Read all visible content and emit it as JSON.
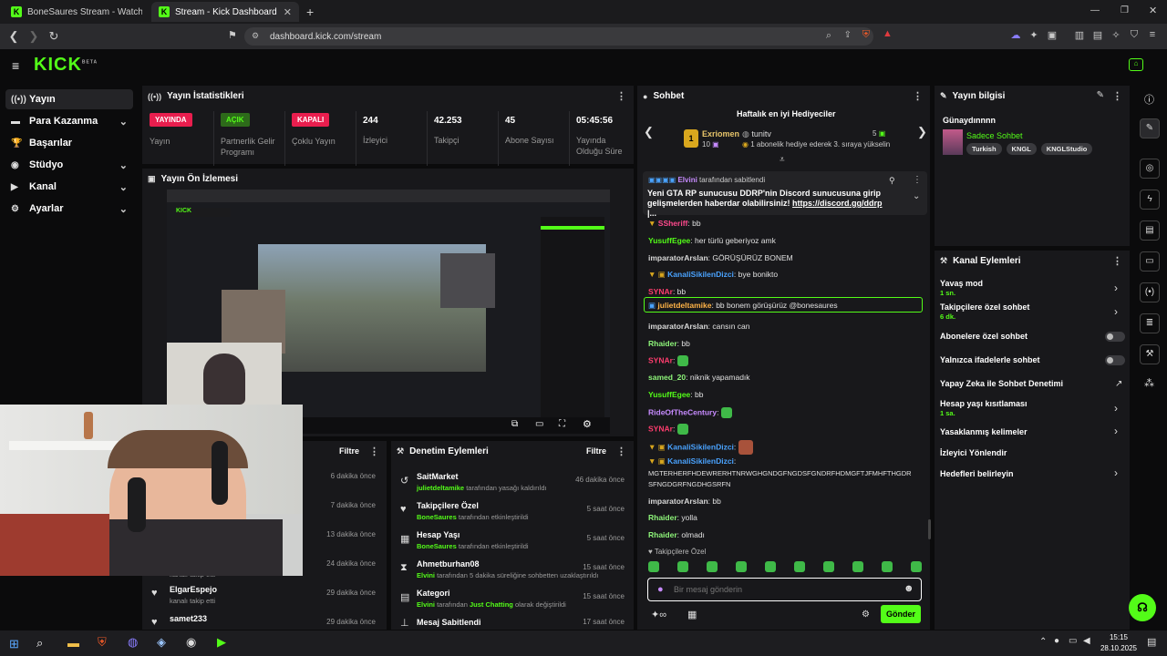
{
  "browser": {
    "tabs": [
      {
        "label": "BoneSaures Stream - Watch Live on"
      },
      {
        "label": "Stream - Kick Dashboard"
      }
    ],
    "new_tab": "+",
    "url": "dashboard.kick.com/stream"
  },
  "site": {
    "logo": "KICK",
    "logo_beta": "BETA"
  },
  "sidebar": {
    "items": [
      {
        "label": "Yayın",
        "icon": "broadcast-icon"
      },
      {
        "label": "Para Kazanma",
        "icon": "money-icon"
      },
      {
        "label": "Başarılar",
        "icon": "trophy-icon"
      },
      {
        "label": "Stüdyo",
        "icon": "studio-icon"
      },
      {
        "label": "Kanal",
        "icon": "channel-icon"
      },
      {
        "label": "Ayarlar",
        "icon": "gear-icon"
      }
    ]
  },
  "stats": {
    "title": "Yayın İstatistikleri",
    "items": [
      {
        "badge": "YAYINDA",
        "label": "Yayın"
      },
      {
        "badge": "AÇIK",
        "label": "Partnerlik Gelir Programı"
      },
      {
        "badge": "KAPALI",
        "label": "Çoklu Yayın"
      },
      {
        "value": "244",
        "label": "İzleyici"
      },
      {
        "value": "42.253",
        "label": "Takipçi"
      },
      {
        "value": "45",
        "label": "Abone Sayısı"
      },
      {
        "value": "05:45:56",
        "label": "Yayında Olduğu Süre"
      }
    ]
  },
  "preview": {
    "title": "Yayın Ön İzlemesi"
  },
  "activity": {
    "filter": "Filtre",
    "rows": [
      {
        "time": "6 dakika önce"
      },
      {
        "time": "7 dakika önce"
      },
      {
        "time": "13 dakika önce"
      },
      {
        "time": "24 dakika önce",
        "sub": "kanalı takip etti"
      },
      {
        "name": "ElgarEspejo",
        "sub": "kanalı takip etti",
        "time": "29 dakika önce"
      },
      {
        "name": "samet233",
        "time": "29 dakika önce"
      }
    ]
  },
  "moderation": {
    "title": "Denetim Eylemleri",
    "filter": "Filtre",
    "rows": [
      {
        "name": "SaitMarket",
        "actor": "julietdeltamike",
        "text": " tarafından yasağı kaldırıldı",
        "time": "46 dakika önce"
      },
      {
        "name": "Takipçilere Özel",
        "actor": "BoneSaures",
        "text": " tarafından etkinleştirildi",
        "time": "5 saat önce"
      },
      {
        "name": "Hesap Yaşı",
        "actor": "BoneSaures",
        "text": " tarafından etkinleştirildi",
        "time": "5 saat önce"
      },
      {
        "name": "Ahmetburhan08",
        "actor": "Elvini",
        "text": " tarafından 5 dakika süreliğine sohbetten uzaklaştırıldı",
        "time": "15 saat önce"
      },
      {
        "name": "Kategori",
        "actor": "Elvini",
        "text": " tarafından ",
        "extra": "Just Chatting",
        "text2": " olarak değiştirildi",
        "time": "15 saat önce"
      },
      {
        "name": "Mesaj Sabitlendi",
        "time": "17 saat önce"
      }
    ]
  },
  "chat": {
    "title": "Sohbet",
    "gifters_title": "Haftalık en iyi Hediyeciler",
    "gifter1": {
      "rank": "1",
      "name": "Exriomen",
      "count": "10"
    },
    "gifter2": {
      "name": "tunitv",
      "count": "5"
    },
    "gifter_note": "1 abonelik hediye ederek 3. sıraya yükselin",
    "pinned_by": "Elvini",
    "pinned_suffix": "tarafından sabitlendi",
    "pinned_text": "Yeni GTA RP sunucusu DDRP'nin Discord sunucusuna girip gelişmelerden haberdar olabilirsiniz! ",
    "pinned_link": "https://discord.gg/ddrp",
    "pinned_more": " |...",
    "messages": [
      {
        "user": "SSheriff",
        "color": "#ff4a8d",
        "text": "bb"
      },
      {
        "user": "YusuffEgee",
        "color": "#53fc18",
        "text": "her türlü geberiyoz amk"
      },
      {
        "user": "imparatorArslan",
        "color": "#d8d8d8",
        "text": "GÖRÜŞÜRÜZ BONEM"
      },
      {
        "user": "KanaliSikilenDizci",
        "color": "#4aa3ff",
        "text": "bye bonikto"
      },
      {
        "user": "SYNAr",
        "color": "#ff3d6e",
        "text": "bb"
      },
      {
        "user": "julietdeltamike",
        "color": "#ffb347",
        "text": "bb bonem görüşürüz @bonesaures"
      },
      {
        "user": "imparatorArslan",
        "color": "#d8d8d8",
        "text": "cansın can"
      },
      {
        "user": "Rhaider",
        "color": "#8ef57a",
        "text": "bb"
      },
      {
        "user": "SYNAr",
        "color": "#ff3d6e",
        "text": ""
      },
      {
        "user": "samed_20",
        "color": "#8ef57a",
        "text": "niknik yapamadık"
      },
      {
        "user": "YusuffEgee",
        "color": "#53fc18",
        "text": "bb"
      },
      {
        "user": "RideOfTheCentury",
        "color": "#c78bff",
        "text": ""
      },
      {
        "user": "SYNAr",
        "color": "#ff3d6e",
        "text": ""
      },
      {
        "user": "KanaliSikilenDizci",
        "color": "#4aa3ff",
        "text": ""
      },
      {
        "user": "KanaliSikilenDizci",
        "color": "#4aa3ff",
        "text": ""
      },
      {
        "user": "",
        "color": "#e0e0e0",
        "text": "MGTERHERFHDEWRERHTNRWGHGNDGFNGDSFGNDRFHDMGFTJFMHFTHGDR"
      },
      {
        "user": "",
        "color": "#e0e0e0",
        "text": "SFNGDGRFNGDHGSRFN"
      },
      {
        "user": "imparatorArslan",
        "color": "#d8d8d8",
        "text": "bb"
      },
      {
        "user": "Rhaider",
        "color": "#8ef57a",
        "text": "yolla"
      },
      {
        "user": "Rhaider",
        "color": "#8ef57a",
        "text": "olmadı"
      }
    ],
    "mode_label": "Takipçilere Özel",
    "input_placeholder": "Bir mesaj gönderin",
    "send": "Gönder"
  },
  "stream_info": {
    "title": "Yayın bilgisi",
    "stream_title": "Günaydınnnn",
    "category": "Sadece Sohbet",
    "tags": [
      "Turkish",
      "KNGL",
      "KNGLStudio"
    ]
  },
  "channel_actions": {
    "title": "Kanal Eylemleri",
    "items": [
      {
        "label": "Yavaş mod",
        "sub": "1 sn.",
        "control": "chevron"
      },
      {
        "label": "Takipçilere özel sohbet",
        "sub": "6 dk.",
        "control": "chevron"
      },
      {
        "label": "Abonelere özel sohbet",
        "control": "toggle"
      },
      {
        "label": "Yalnızca ifadelerle sohbet",
        "control": "toggle"
      },
      {
        "label": "Yapay Zeka ile Sohbet Denetimi",
        "control": "external"
      },
      {
        "label": "Hesap yaşı kısıtlaması",
        "sub": "1 sa.",
        "control": "chevron"
      },
      {
        "label": "Yasaklanmış kelimeler",
        "control": "chevron"
      },
      {
        "label": "İzleyici Yönlendir",
        "control": "none"
      },
      {
        "label": "Hedefleri belirleyin",
        "control": "chevron"
      }
    ]
  },
  "taskbar": {
    "time": "15:15",
    "date": "28.10.2025"
  },
  "colors": {
    "accent": "#53fc18",
    "live_red": "#e91e4e",
    "bg": "#0b0b0c",
    "panel": "#18181b"
  }
}
